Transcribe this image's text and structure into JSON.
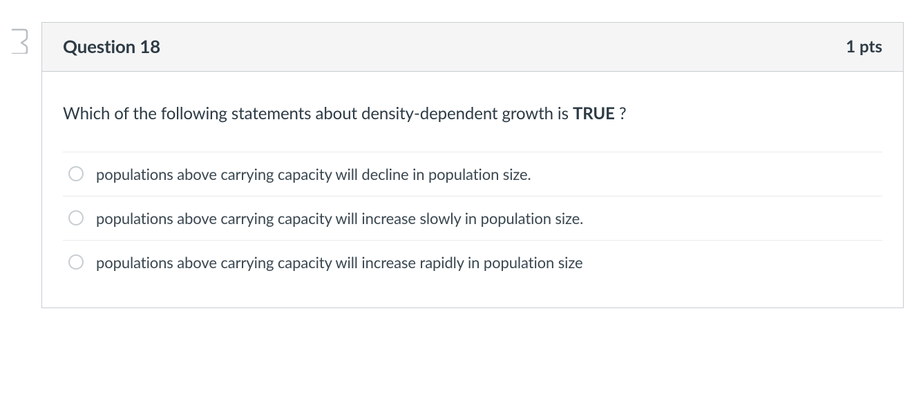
{
  "question": {
    "title": "Question 18",
    "points": "1 pts",
    "prompt_prefix": "Which of the following statements about density-dependent growth is ",
    "prompt_bold": "TRUE",
    "prompt_suffix": " ?",
    "options": [
      "populations above carrying capacity will decline in population size.",
      "populations above carrying capacity will increase slowly in population size.",
      "populations above carrying capacity will increase rapidly in population size"
    ]
  }
}
